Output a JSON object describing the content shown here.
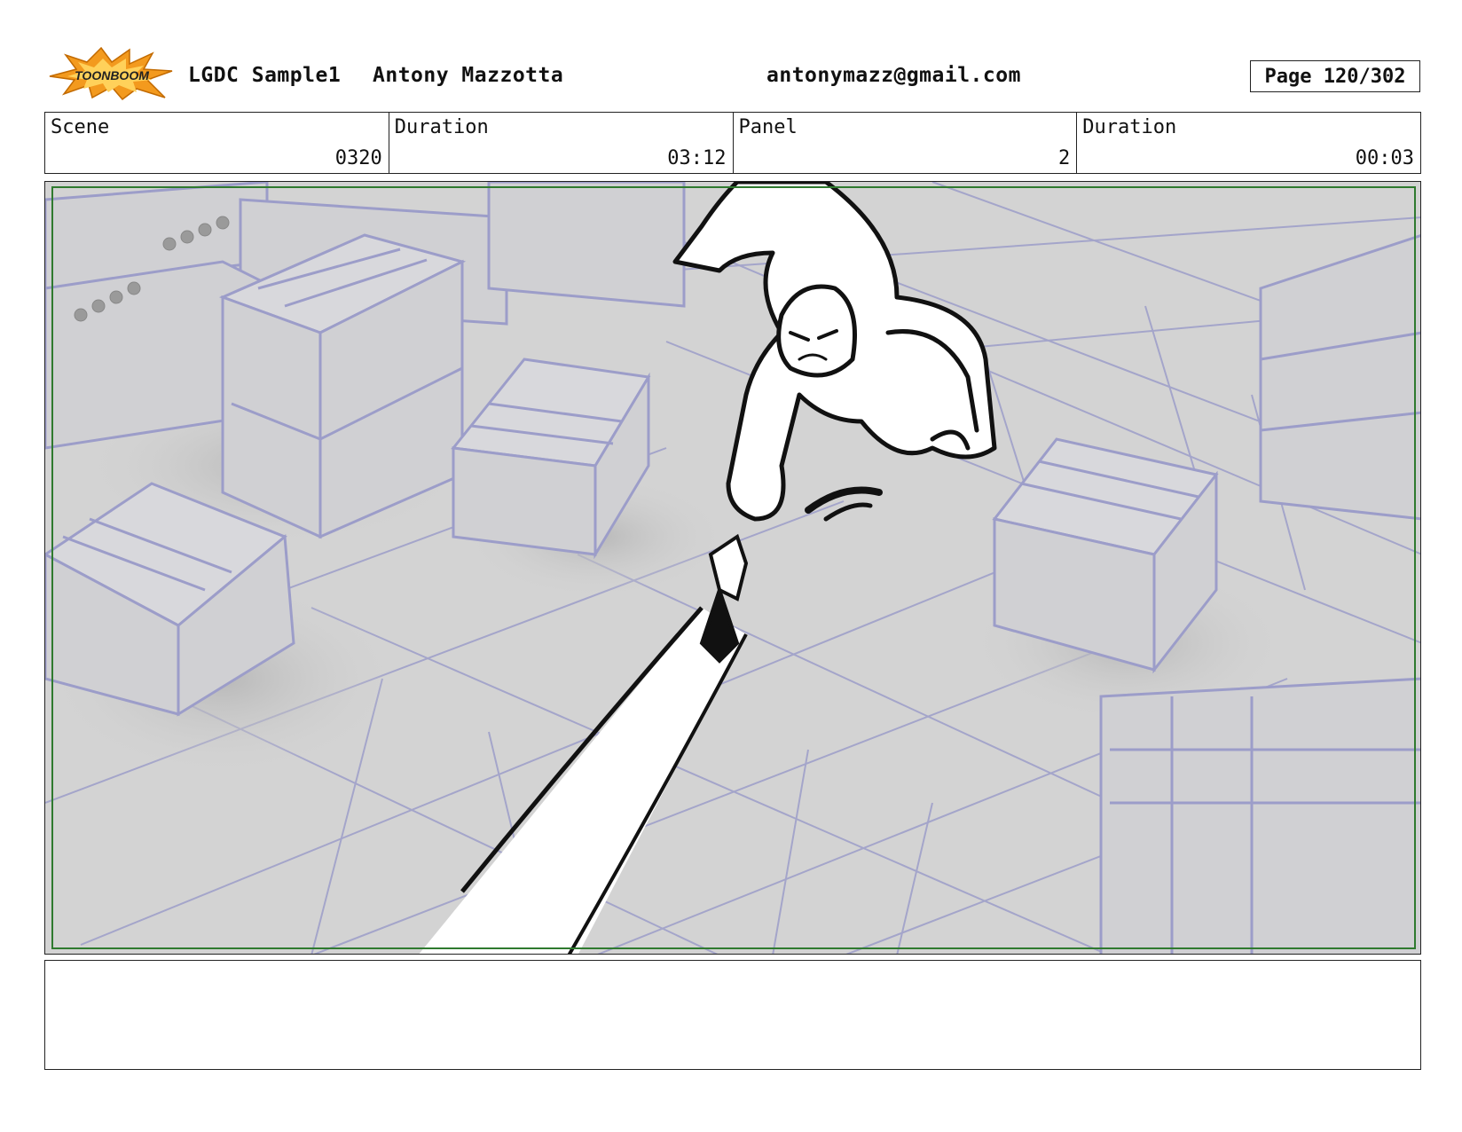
{
  "header": {
    "logo_text": "TOONBOOM",
    "project": "LGDC Sample1",
    "author": "Antony Mazzotta",
    "email": "antonymazz@gmail.com",
    "page": "Page 120/302"
  },
  "info": {
    "scene_label": "Scene",
    "scene_value": "0320",
    "scene_duration_label": "Duration",
    "scene_duration_value": "03:12",
    "panel_label": "Panel",
    "panel_value": "2",
    "panel_duration_label": "Duration",
    "panel_duration_value": "00:03"
  },
  "notes": {
    "text": ""
  },
  "colors": {
    "background_grey": "#d3d3d3",
    "layout_lines": "#9c9dc9",
    "safe_frame": "#2f7a2f",
    "sketch_ink": "#111111",
    "logo_orange": "#f39a1e"
  }
}
